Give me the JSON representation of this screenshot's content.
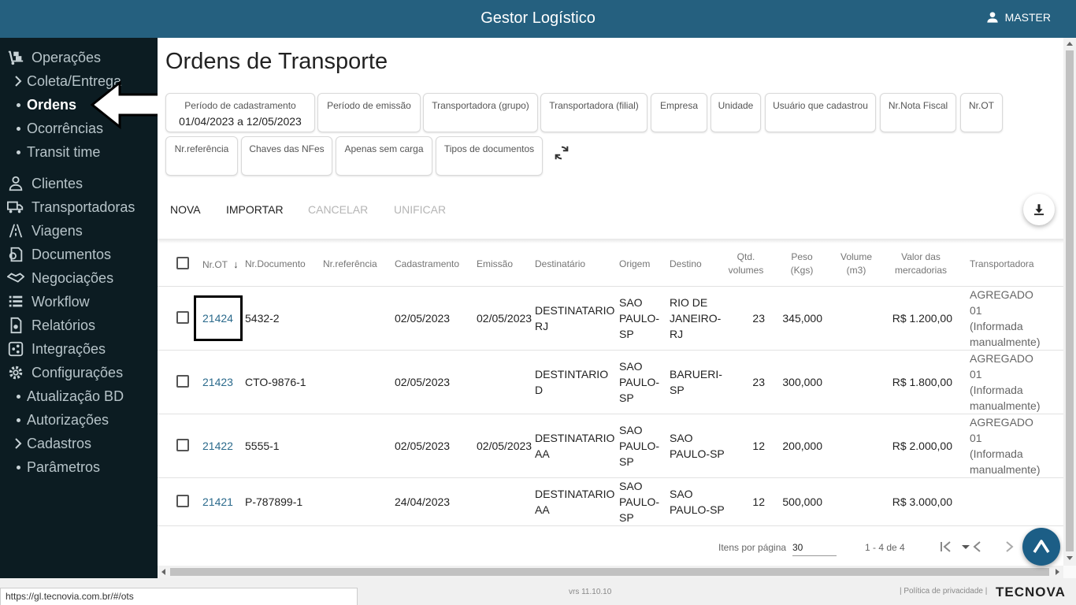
{
  "header": {
    "title": "Gestor Logístico",
    "user": "MASTER"
  },
  "sidebar": {
    "items": [
      {
        "label": "Operações"
      },
      {
        "label": "Coleta/Entrega"
      },
      {
        "label": "Ordens"
      },
      {
        "label": "Ocorrências"
      },
      {
        "label": "Transit time"
      },
      {
        "label": "Clientes"
      },
      {
        "label": "Transportadoras"
      },
      {
        "label": "Viagens"
      },
      {
        "label": "Documentos"
      },
      {
        "label": "Negociações"
      },
      {
        "label": "Workflow"
      },
      {
        "label": "Relatórios"
      },
      {
        "label": "Integrações"
      },
      {
        "label": "Configurações"
      },
      {
        "label": "Atualização BD"
      },
      {
        "label": "Autorizações"
      },
      {
        "label": "Cadastros"
      },
      {
        "label": "Parâmetros"
      }
    ]
  },
  "page": {
    "title": "Ordens de Transporte"
  },
  "filters": {
    "periodo_cadastro": {
      "label": "Período de cadastramento",
      "value": "01/04/2023 a 12/05/2023"
    },
    "periodo_emissao": "Período de emissão",
    "transp_grupo": "Transportadora (grupo)",
    "transp_filial": "Transportadora (filial)",
    "empresa": "Empresa",
    "unidade": "Unidade",
    "usuario": "Usuário que cadastrou",
    "nota_fiscal": "Nr.Nota Fiscal",
    "nr_ot": "Nr.OT",
    "nr_ref": "Nr.referência",
    "chaves": "Chaves das NFes",
    "sem_carga": "Apenas sem carga",
    "tipos_doc": "Tipos de documentos"
  },
  "actions": {
    "nova": "NOVA",
    "importar": "IMPORTAR",
    "cancelar": "CANCELAR",
    "unificar": "UNIFICAR"
  },
  "table": {
    "headers": {
      "nr_ot": "Nr.OT",
      "nr_documento": "Nr.Documento",
      "nr_referencia": "Nr.referência",
      "cadastramento": "Cadastramento",
      "emissao": "Emissão",
      "destinatario": "Destinatário",
      "origem": "Origem",
      "destino": "Destino",
      "qtd_volumes_1": "Qtd.",
      "qtd_volumes_2": "volumes",
      "peso_1": "Peso",
      "peso_2": "(Kgs)",
      "volume_1": "Volume",
      "volume_2": "(m3)",
      "valor_1": "Valor das",
      "valor_2": "mercadorias",
      "transportadora": "Transportadora"
    },
    "rows": [
      {
        "nr_ot": "21424",
        "nr_documento": "5432-2",
        "cadastramento": "02/05/2023",
        "emissao": "02/05/2023",
        "dest_1": "DESTINATARIO",
        "dest_2": "RJ",
        "orig_1": "SAO",
        "orig_2": "PAULO-",
        "orig_3": "SP",
        "destino_1": "RIO DE",
        "destino_2": "JANEIRO-",
        "destino_3": "RJ",
        "qtd": "23",
        "peso": "345,000",
        "valor": "R$ 1.200,00",
        "transp_1": "AGREGADO",
        "transp_2": "01",
        "transp_3": "(Informada",
        "transp_4": "manualmente)"
      },
      {
        "nr_ot": "21423",
        "nr_documento": "CTO-9876-1",
        "cadastramento": "02/05/2023",
        "emissao": "",
        "dest_1": "DESTINTARIO",
        "dest_2": "D",
        "orig_1": "SAO",
        "orig_2": "PAULO-",
        "orig_3": "SP",
        "destino_1": "BARUERI-",
        "destino_2": "SP",
        "destino_3": "",
        "qtd": "23",
        "peso": "300,000",
        "valor": "R$ 1.800,00",
        "transp_1": "AGREGADO",
        "transp_2": "01",
        "transp_3": "(Informada",
        "transp_4": "manualmente)"
      },
      {
        "nr_ot": "21422",
        "nr_documento": "5555-1",
        "cadastramento": "02/05/2023",
        "emissao": "02/05/2023",
        "dest_1": "DESTINATARIO",
        "dest_2": "AA",
        "orig_1": "SAO",
        "orig_2": "PAULO-",
        "orig_3": "SP",
        "destino_1": "SAO",
        "destino_2": "PAULO-SP",
        "destino_3": "",
        "qtd": "12",
        "peso": "200,000",
        "valor": "R$ 2.000,00",
        "transp_1": "AGREGADO",
        "transp_2": "01",
        "transp_3": "(Informada",
        "transp_4": "manualmente)"
      },
      {
        "nr_ot": "21421",
        "nr_documento": "P-787899-1",
        "cadastramento": "24/04/2023",
        "emissao": "",
        "dest_1": "DESTINATARIO",
        "dest_2": "AA",
        "orig_1": "SAO",
        "orig_2": "PAULO-",
        "orig_3": "SP",
        "destino_1": "SAO",
        "destino_2": "PAULO-SP",
        "destino_3": "",
        "qtd": "12",
        "peso": "500,000",
        "valor": "R$ 3.000,00",
        "transp_1": "",
        "transp_2": "",
        "transp_3": "",
        "transp_4": ""
      }
    ]
  },
  "pager": {
    "label": "Itens por página",
    "page_size": "30",
    "range": "1 - 4 de 4"
  },
  "footer": {
    "status_url": "https://gl.tecnovia.com.br/#/ots",
    "version": "vrs 11.10.10",
    "privacy": "|  Política de privacidade  |",
    "brand": "TECNOVA"
  },
  "colors": {
    "header": "#25607f",
    "sidebar": "#0c1c22",
    "link": "#2b6a8c",
    "fab": "#1c5e86"
  }
}
